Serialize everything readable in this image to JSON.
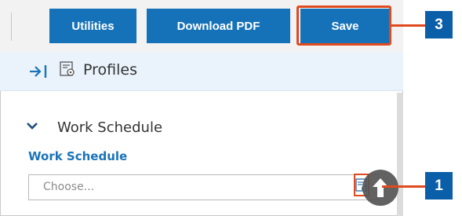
{
  "toolbar": {
    "utilities_label": "Utilities",
    "download_pdf_label": "Download PDF",
    "save_label": "Save"
  },
  "panel": {
    "title": "Profiles",
    "collapse_icon": "collapse-right-icon",
    "title_icon": "profiles-icon"
  },
  "section": {
    "title": "Work Schedule",
    "expanded": true,
    "field_label": "Work Schedule",
    "select_placeholder": "Choose...",
    "lookup_icon": "lookup-icon"
  },
  "scroll_to_top_icon": "arrow-up-icon",
  "callouts": {
    "save": "3",
    "lookup": "1"
  },
  "colors": {
    "button_blue": "#1672b8",
    "highlight": "#e14a1e",
    "badge": "#0b5ea8",
    "label_blue": "#1a73b8"
  }
}
